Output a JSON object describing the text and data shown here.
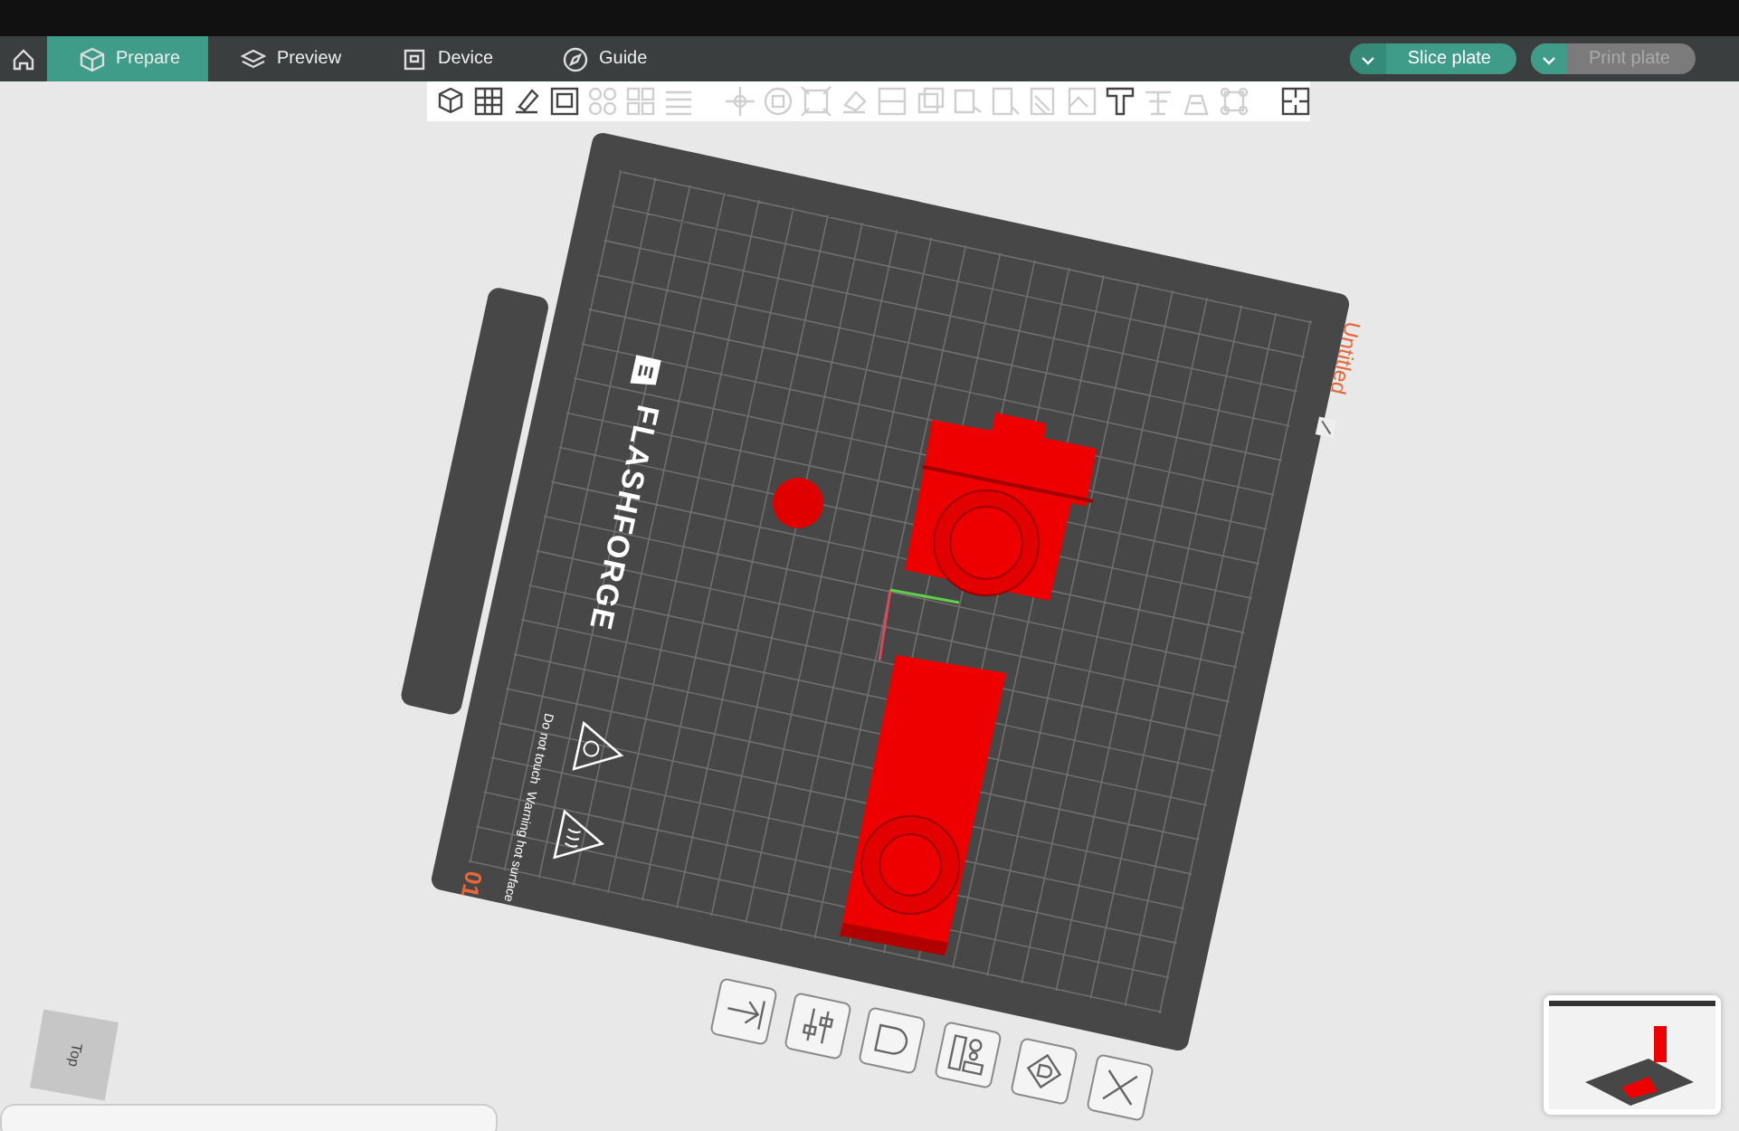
{
  "tabs": [
    {
      "label": "Prepare",
      "selected": true
    },
    {
      "label": "Preview",
      "selected": false
    },
    {
      "label": "Device",
      "selected": false
    },
    {
      "label": "Guide",
      "selected": false
    }
  ],
  "actions": [
    {
      "label": "Slice plate",
      "disabled": false
    },
    {
      "label": "Print plate",
      "disabled": true
    }
  ],
  "toolbar": [
    {
      "kind": "tool",
      "disabled": false
    },
    {
      "kind": "tool",
      "disabled": false
    },
    {
      "kind": "tool",
      "disabled": false
    },
    {
      "kind": "tool",
      "disabled": false
    },
    {
      "kind": "tool",
      "disabled": true
    },
    {
      "kind": "tool",
      "disabled": true
    },
    {
      "kind": "tool",
      "disabled": true
    },
    {
      "kind": "separator"
    },
    {
      "kind": "tool",
      "disabled": true
    },
    {
      "kind": "tool",
      "disabled": true
    },
    {
      "kind": "tool",
      "disabled": true
    },
    {
      "kind": "tool",
      "disabled": true
    },
    {
      "kind": "tool",
      "disabled": true
    },
    {
      "kind": "tool",
      "disabled": true
    },
    {
      "kind": "tool",
      "disabled": true
    },
    {
      "kind": "tool",
      "disabled": true
    },
    {
      "kind": "tool",
      "disabled": true
    },
    {
      "kind": "tool",
      "disabled": true
    },
    {
      "kind": "tool",
      "disabled": false
    },
    {
      "kind": "tool",
      "disabled": true
    },
    {
      "kind": "tool",
      "disabled": true
    },
    {
      "kind": "tool",
      "disabled": true
    },
    {
      "kind": "separator"
    },
    {
      "kind": "tool",
      "disabled": false
    }
  ],
  "plate": {
    "brand": "FLASHFORGE",
    "name": "Untitled",
    "number": "01",
    "warnings": [
      "Do not touch",
      "Warning hot surface"
    ]
  },
  "view_cube": {
    "label": "Top"
  }
}
